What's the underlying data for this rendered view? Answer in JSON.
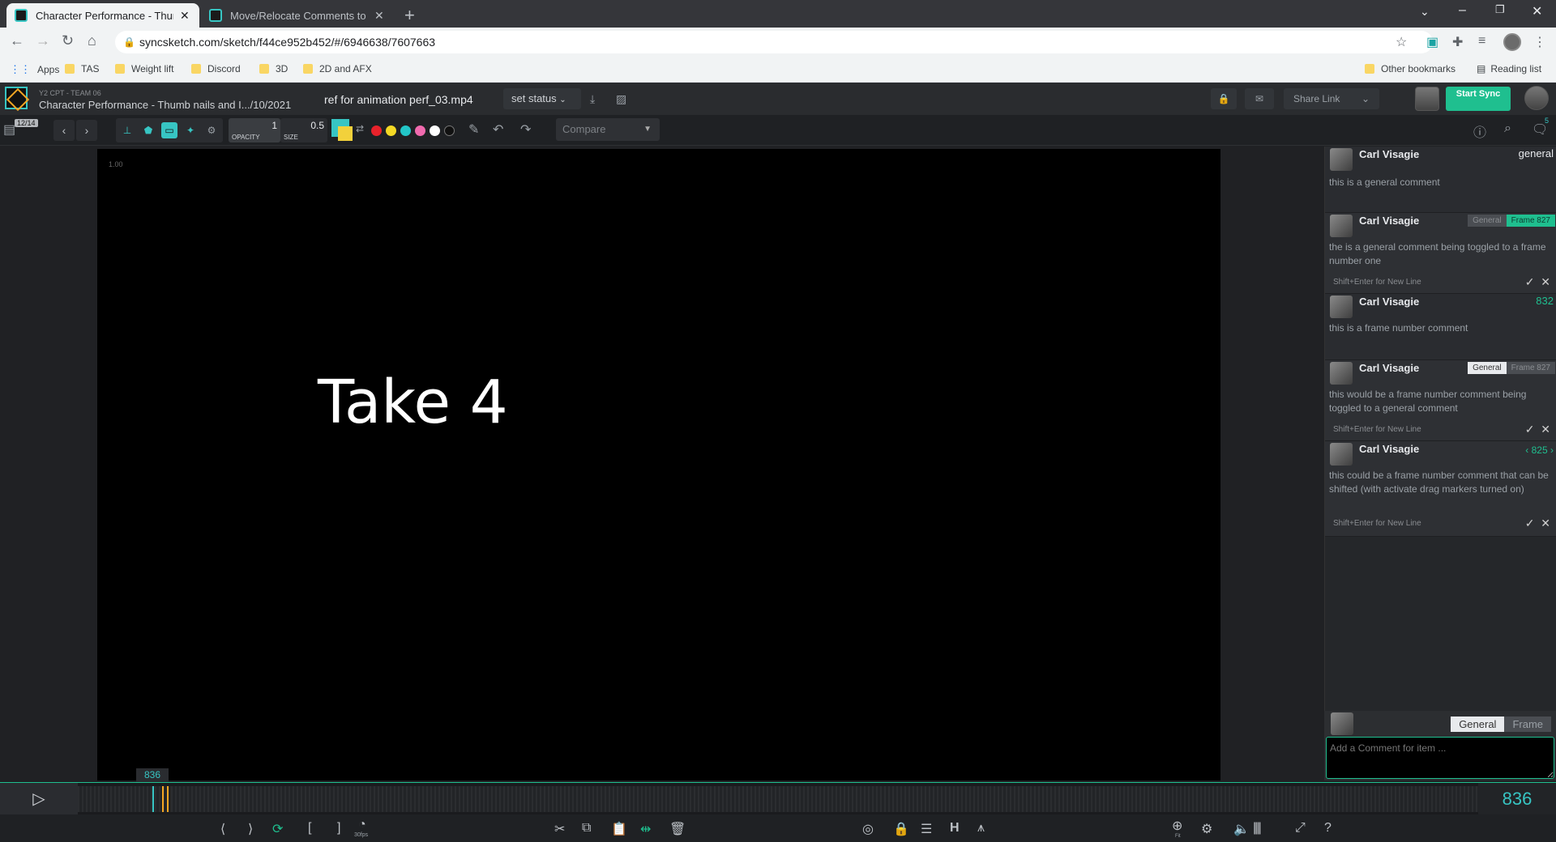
{
  "browser": {
    "tabs": [
      {
        "title": "Character Performance - Thumb",
        "active": true
      },
      {
        "title": "Move/Relocate Comments to Ne",
        "active": false
      }
    ],
    "url": "syncsketch.com/sketch/f44ce952b452/#/6946638/7607663",
    "bookmarks": [
      "Apps",
      "TAS",
      "Weight lift",
      "Discord",
      "3D",
      "2D and AFX"
    ],
    "bookmarks_right": [
      "Other bookmarks",
      "Reading list"
    ]
  },
  "header": {
    "team": "Y2 CPT - TEAM 06",
    "project": "Character Performance - Thumb nails and I.../10/2021",
    "file": "ref for animation perf_03.mp4",
    "set_status": "set status",
    "share_link": "Share Link",
    "start_sync": "Start Sync"
  },
  "toolbar": {
    "page": "12/14",
    "opacity_label": "OPACITY",
    "opacity_value": "1",
    "size_label": "SIZE",
    "size_value": "0.5",
    "compare": "Compare",
    "colors": [
      "#e8222b",
      "#f4d925",
      "#23c6c8",
      "#f06aae",
      "#ffffff",
      "#111111"
    ],
    "comments_count": "5"
  },
  "viewer": {
    "zoom": "1.00",
    "frame_text": "Take 4"
  },
  "comments": [
    {
      "author": "Carl Visagie",
      "tag": "general",
      "text": "this is a general comment"
    },
    {
      "author": "Carl Visagie",
      "toggle_a": "General",
      "toggle_b": "Frame 827",
      "text": "the is a general comment being toggled to a frame number one",
      "hint": "Shift+Enter for New Line"
    },
    {
      "author": "Carl Visagie",
      "tag": "832",
      "text": "this is a frame number comment"
    },
    {
      "author": "Carl Visagie",
      "toggle_a": "General",
      "toggle_b": "Frame 827",
      "text": "this would be a frame number comment being toggled to a general comment",
      "hint": "Shift+Enter for New Line"
    },
    {
      "author": "Carl Visagie",
      "tag": "825",
      "text": "this could be a frame number comment that can be shifted (with activate drag markers turned on)",
      "hint": "Shift+Enter for New Line"
    }
  ],
  "composer": {
    "general": "General",
    "frame": "Frame",
    "placeholder": "Add a Comment for item ..."
  },
  "timeline": {
    "current_frame": "836",
    "fps": "30fps",
    "fit": "Fit"
  }
}
